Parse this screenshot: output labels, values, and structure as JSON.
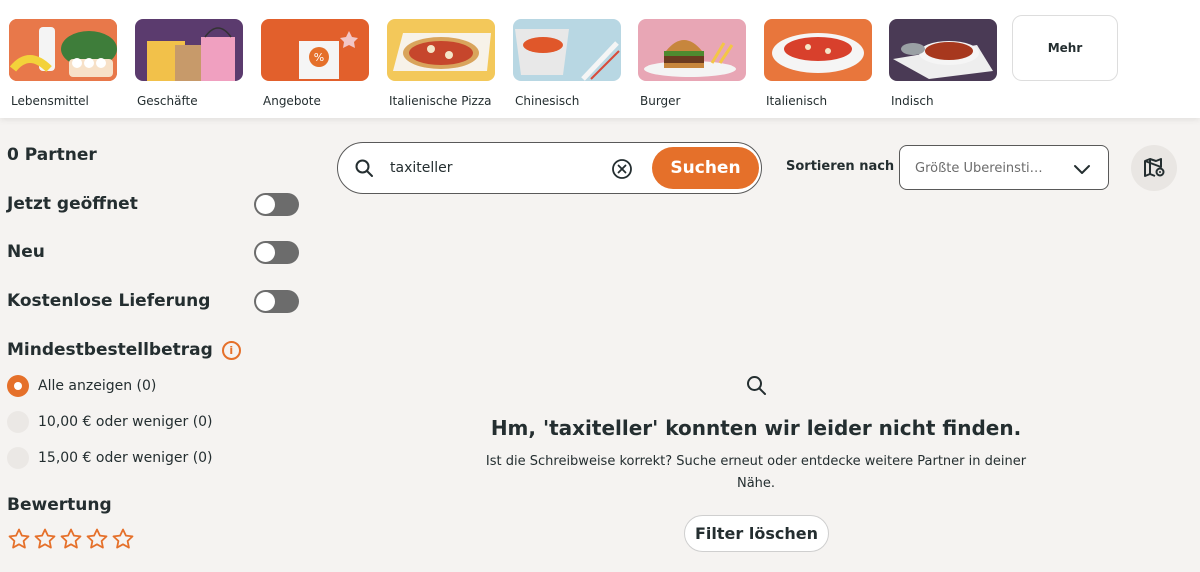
{
  "categories": [
    {
      "label": "Lebensmittel",
      "bg": "#e8784a",
      "icon": "groceries-image"
    },
    {
      "label": "Geschäfte",
      "bg": "#5b3b6e",
      "icon": "shopping-bags-image"
    },
    {
      "label": "Angebote",
      "bg": "#e2602c",
      "icon": "offer-bag-image"
    },
    {
      "label": "Italienische Pizza",
      "bg": "#f3c85a",
      "icon": "pizza-image"
    },
    {
      "label": "Chinesisch",
      "bg": "#b8d7e3",
      "icon": "chinese-box-image"
    },
    {
      "label": "Burger",
      "bg": "#e8a6b5",
      "icon": "burger-image"
    },
    {
      "label": "Italienisch",
      "bg": "#e8763c",
      "icon": "pasta-image"
    },
    {
      "label": "Indisch",
      "bg": "#4a3a55",
      "icon": "curry-image"
    }
  ],
  "more_label": "Mehr",
  "sidebar": {
    "partner_count": "0 Partner",
    "filters": [
      {
        "label": "Jetzt geöffnet",
        "on": false
      },
      {
        "label": "Neu",
        "on": false
      },
      {
        "label": "Kostenlose Lieferung",
        "on": false
      }
    ],
    "min_order_title": "Mindestbestellbetrag",
    "min_order_options": [
      {
        "label": "Alle anzeigen (0)",
        "checked": true
      },
      {
        "label": "10,00 € oder weniger (0)",
        "checked": false
      },
      {
        "label": "15,00 € oder weniger (0)",
        "checked": false
      }
    ],
    "rating_title": "Bewertung",
    "rating_stars": 5
  },
  "search": {
    "value": "taxiteller",
    "button_label": "Suchen"
  },
  "sort": {
    "label": "Sortieren nach",
    "selected": "Größte Übereinstimmung"
  },
  "empty_state": {
    "title": "Hm, 'taxiteller' konnten wir leider nicht finden.",
    "text": "Ist die Schreibweise korrekt? Suche erneut oder entdecke weitere Partner in deiner Nähe.",
    "button_label": "Filter löschen"
  },
  "colors": {
    "accent": "#e5702a",
    "toggle_off": "#6c6c6c",
    "background": "#f5f3f1"
  }
}
